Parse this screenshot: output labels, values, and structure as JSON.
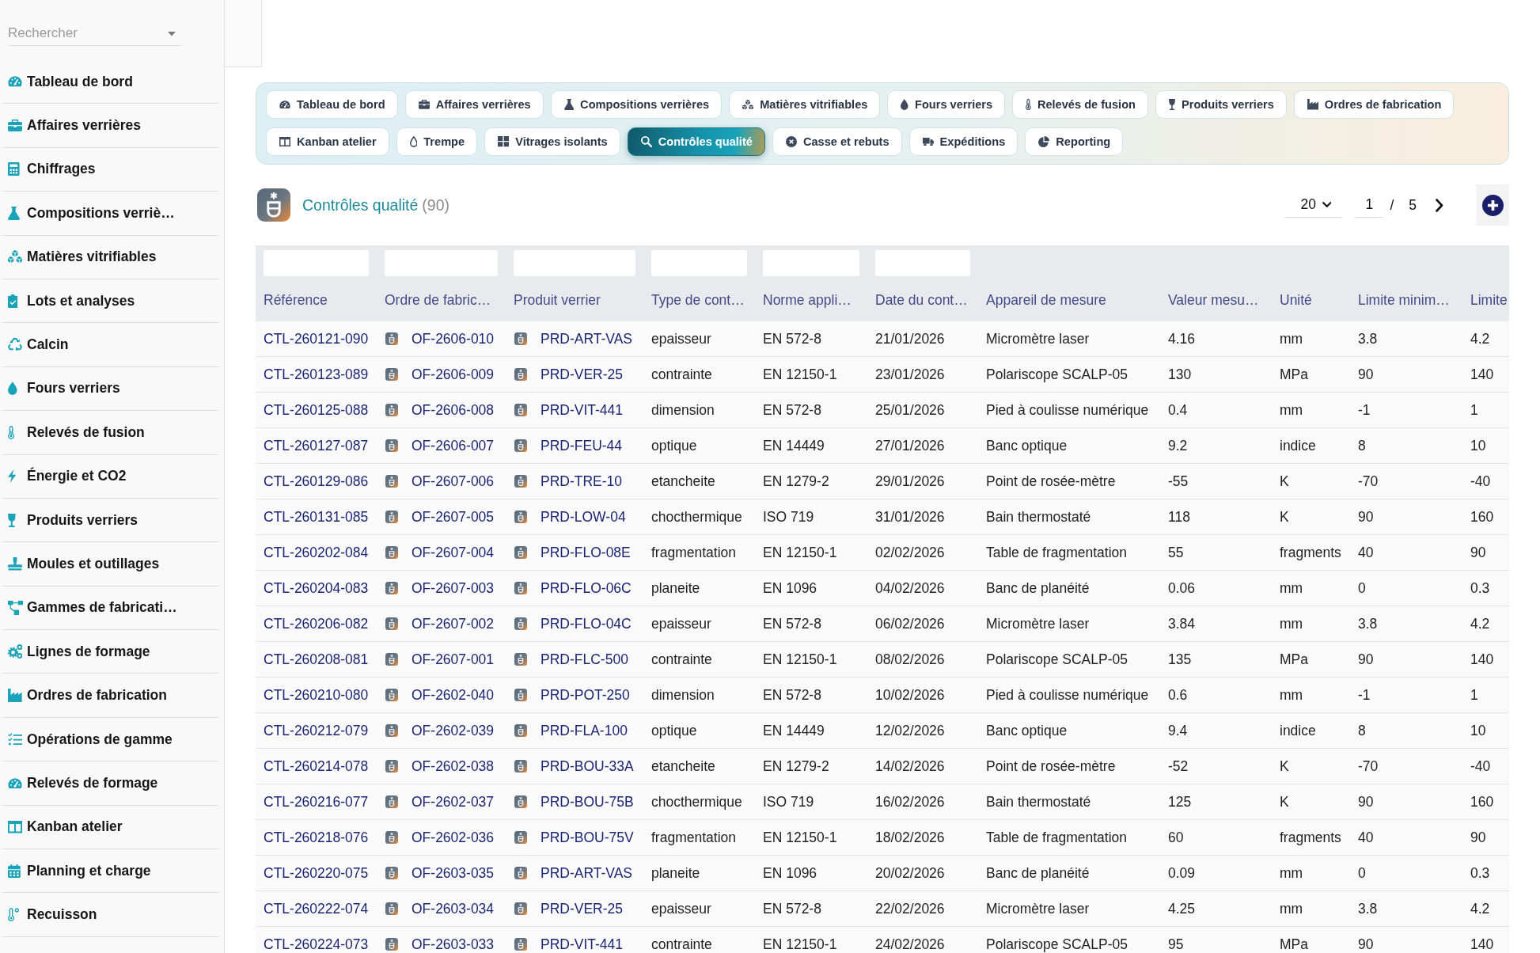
{
  "sidebar": {
    "search": {
      "placeholder": "Rechercher"
    },
    "items": [
      {
        "label": "Tableau de bord"
      },
      {
        "label": "Affaires verrières"
      },
      {
        "label": "Chiffrages"
      },
      {
        "label": "Compositions verriè…"
      },
      {
        "label": "Matières vitrifiables"
      },
      {
        "label": "Lots et analyses"
      },
      {
        "label": "Calcin"
      },
      {
        "label": "Fours verriers"
      },
      {
        "label": "Relevés de fusion"
      },
      {
        "label": "Énergie et CO2"
      },
      {
        "label": "Produits verriers"
      },
      {
        "label": "Moules et outillages"
      },
      {
        "label": "Gammes de fabricati…"
      },
      {
        "label": "Lignes de formage"
      },
      {
        "label": "Ordres de fabrication"
      },
      {
        "label": "Opérations de gamme"
      },
      {
        "label": "Relevés de formage"
      },
      {
        "label": "Kanban atelier"
      },
      {
        "label": "Planning et charge"
      },
      {
        "label": "Recuisson"
      }
    ]
  },
  "tabs": [
    {
      "label": "Tableau de bord",
      "selected": false
    },
    {
      "label": "Affaires verrières",
      "selected": false
    },
    {
      "label": "Compositions verrières",
      "selected": false
    },
    {
      "label": "Matières vitrifiables",
      "selected": false
    },
    {
      "label": "Fours verriers",
      "selected": false
    },
    {
      "label": "Relevés de fusion",
      "selected": false
    },
    {
      "label": "Produits verriers",
      "selected": false
    },
    {
      "label": "Ordres de fabrication",
      "selected": false
    },
    {
      "label": "Kanban atelier",
      "selected": false
    },
    {
      "label": "Trempe",
      "selected": false
    },
    {
      "label": "Vitrages isolants",
      "selected": false
    },
    {
      "label": "Contrôles qualité",
      "selected": true
    },
    {
      "label": "Casse et rebuts",
      "selected": false
    },
    {
      "label": "Expéditions",
      "selected": false
    },
    {
      "label": "Reporting",
      "selected": false
    }
  ],
  "header": {
    "title": "Contrôles qualité",
    "count": "(90)"
  },
  "pagination": {
    "page_size": "20",
    "page": "1",
    "separator": "/",
    "total_pages": "5"
  },
  "table": {
    "columns": [
      {
        "label": "Référence",
        "kind": "link",
        "filter": true
      },
      {
        "label": "Ordre de fabric…",
        "kind": "icon-link",
        "filter": true
      },
      {
        "label": "Produit verrier",
        "kind": "icon-link",
        "filter": true
      },
      {
        "label": "Type de cont…",
        "kind": "text",
        "filter": true
      },
      {
        "label": "Norme appli…",
        "kind": "text",
        "filter": true
      },
      {
        "label": "Date du cont…",
        "kind": "text",
        "filter": true
      },
      {
        "label": "Appareil de mesure",
        "kind": "text",
        "filter": false
      },
      {
        "label": "Valeur mesu…",
        "kind": "text",
        "filter": false
      },
      {
        "label": "Unité",
        "kind": "text",
        "filter": false
      },
      {
        "label": "Limite minim…",
        "kind": "text",
        "filter": false
      },
      {
        "label": "Limite",
        "kind": "text",
        "filter": false
      }
    ],
    "rows": [
      [
        "CTL-260121-090",
        "OF-2606-010",
        "PRD-ART-VAS",
        "epaisseur",
        "EN 572-8",
        "21/01/2026",
        "Micromètre laser",
        "4.16",
        "mm",
        "3.8",
        "4.2"
      ],
      [
        "CTL-260123-089",
        "OF-2606-009",
        "PRD-VER-25",
        "contrainte",
        "EN 12150-1",
        "23/01/2026",
        "Polariscope SCALP-05",
        "130",
        "MPa",
        "90",
        "140"
      ],
      [
        "CTL-260125-088",
        "OF-2606-008",
        "PRD-VIT-441",
        "dimension",
        "EN 572-8",
        "25/01/2026",
        "Pied à coulisse numérique",
        "0.4",
        "mm",
        "-1",
        "1"
      ],
      [
        "CTL-260127-087",
        "OF-2606-007",
        "PRD-FEU-44",
        "optique",
        "EN 14449",
        "27/01/2026",
        "Banc optique",
        "9.2",
        "indice",
        "8",
        "10"
      ],
      [
        "CTL-260129-086",
        "OF-2607-006",
        "PRD-TRE-10",
        "etancheite",
        "EN 1279-2",
        "29/01/2026",
        "Point de rosée-mètre",
        "-55",
        "K",
        "-70",
        "-40"
      ],
      [
        "CTL-260131-085",
        "OF-2607-005",
        "PRD-LOW-04",
        "chocthermique",
        "ISO 719",
        "31/01/2026",
        "Bain thermostaté",
        "118",
        "K",
        "90",
        "160"
      ],
      [
        "CTL-260202-084",
        "OF-2607-004",
        "PRD-FLO-08E",
        "fragmentation",
        "EN 12150-1",
        "02/02/2026",
        "Table de fragmentation",
        "55",
        "fragments",
        "40",
        "90"
      ],
      [
        "CTL-260204-083",
        "OF-2607-003",
        "PRD-FLO-06C",
        "planeite",
        "EN 1096",
        "04/02/2026",
        "Banc de planéité",
        "0.06",
        "mm",
        "0",
        "0.3"
      ],
      [
        "CTL-260206-082",
        "OF-2607-002",
        "PRD-FLO-04C",
        "epaisseur",
        "EN 572-8",
        "06/02/2026",
        "Micromètre laser",
        "3.84",
        "mm",
        "3.8",
        "4.2"
      ],
      [
        "CTL-260208-081",
        "OF-2607-001",
        "PRD-FLC-500",
        "contrainte",
        "EN 12150-1",
        "08/02/2026",
        "Polariscope SCALP-05",
        "135",
        "MPa",
        "90",
        "140"
      ],
      [
        "CTL-260210-080",
        "OF-2602-040",
        "PRD-POT-250",
        "dimension",
        "EN 572-8",
        "10/02/2026",
        "Pied à coulisse numérique",
        "0.6",
        "mm",
        "-1",
        "1"
      ],
      [
        "CTL-260212-079",
        "OF-2602-039",
        "PRD-FLA-100",
        "optique",
        "EN 14449",
        "12/02/2026",
        "Banc optique",
        "9.4",
        "indice",
        "8",
        "10"
      ],
      [
        "CTL-260214-078",
        "OF-2602-038",
        "PRD-BOU-33A",
        "etancheite",
        "EN 1279-2",
        "14/02/2026",
        "Point de rosée-mètre",
        "-52",
        "K",
        "-70",
        "-40"
      ],
      [
        "CTL-260216-077",
        "OF-2602-037",
        "PRD-BOU-75B",
        "chocthermique",
        "ISO 719",
        "16/02/2026",
        "Bain thermostaté",
        "125",
        "K",
        "90",
        "160"
      ],
      [
        "CTL-260218-076",
        "OF-2602-036",
        "PRD-BOU-75V",
        "fragmentation",
        "EN 12150-1",
        "18/02/2026",
        "Table de fragmentation",
        "60",
        "fragments",
        "40",
        "90"
      ],
      [
        "CTL-260220-075",
        "OF-2603-035",
        "PRD-ART-VAS",
        "planeite",
        "EN 1096",
        "20/02/2026",
        "Banc de planéité",
        "0.09",
        "mm",
        "0",
        "0.3"
      ],
      [
        "CTL-260222-074",
        "OF-2603-034",
        "PRD-VER-25",
        "epaisseur",
        "EN 572-8",
        "22/02/2026",
        "Micromètre laser",
        "4.25",
        "mm",
        "3.8",
        "4.2"
      ],
      [
        "CTL-260224-073",
        "OF-2603-033",
        "PRD-VIT-441",
        "contrainte",
        "EN 12150-1",
        "24/02/2026",
        "Polariscope SCALP-05",
        "95",
        "MPa",
        "90",
        "140"
      ]
    ]
  }
}
